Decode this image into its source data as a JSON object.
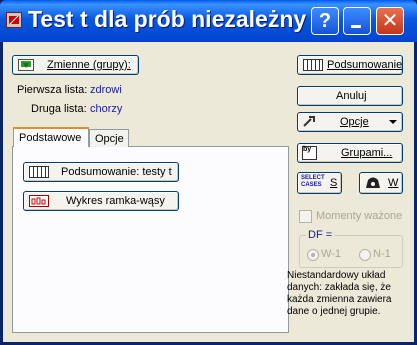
{
  "window": {
    "title": "Test t dla prób niezależny",
    "help_label": "?",
    "close_label": "✕"
  },
  "variables": {
    "button_label": "Zmienne (grupy):",
    "first_list_label": "Pierwsza lista:",
    "first_list_value": "zdrowi",
    "second_list_label": "Druga lista:",
    "second_list_value": "chorzy"
  },
  "tabs": [
    {
      "label": "Podstawowe",
      "active": true
    },
    {
      "label": "Opcje",
      "active": false
    }
  ],
  "basic_tab": {
    "summary_button": "Podsumowanie: testy t",
    "boxplot_button": "Wykres ramka-wąsy"
  },
  "side": {
    "summary_button": "Podsumowanie",
    "cancel_button": "Anuluj",
    "options_button": "Opcje",
    "groups_button": "Grupami...",
    "select_cases_line1": "SELECT",
    "select_cases_line2": "CASES",
    "select_cases_letter": "S",
    "weight_letter": "W",
    "moments_checkbox_label": "Momenty ważone",
    "df_legend": "DF =",
    "df_option_1": "W-1",
    "df_option_2": "N-1",
    "note_text": "Niestandardowy układ danych: zakłada się, że każda zmienna zawiera dane o jednej grupie."
  },
  "colors": {
    "title_bar": "#0058ee",
    "accent_blue_text": "#1a1aa8",
    "tab_highlight": "#e68b2c",
    "close_button": "#c4351a"
  }
}
